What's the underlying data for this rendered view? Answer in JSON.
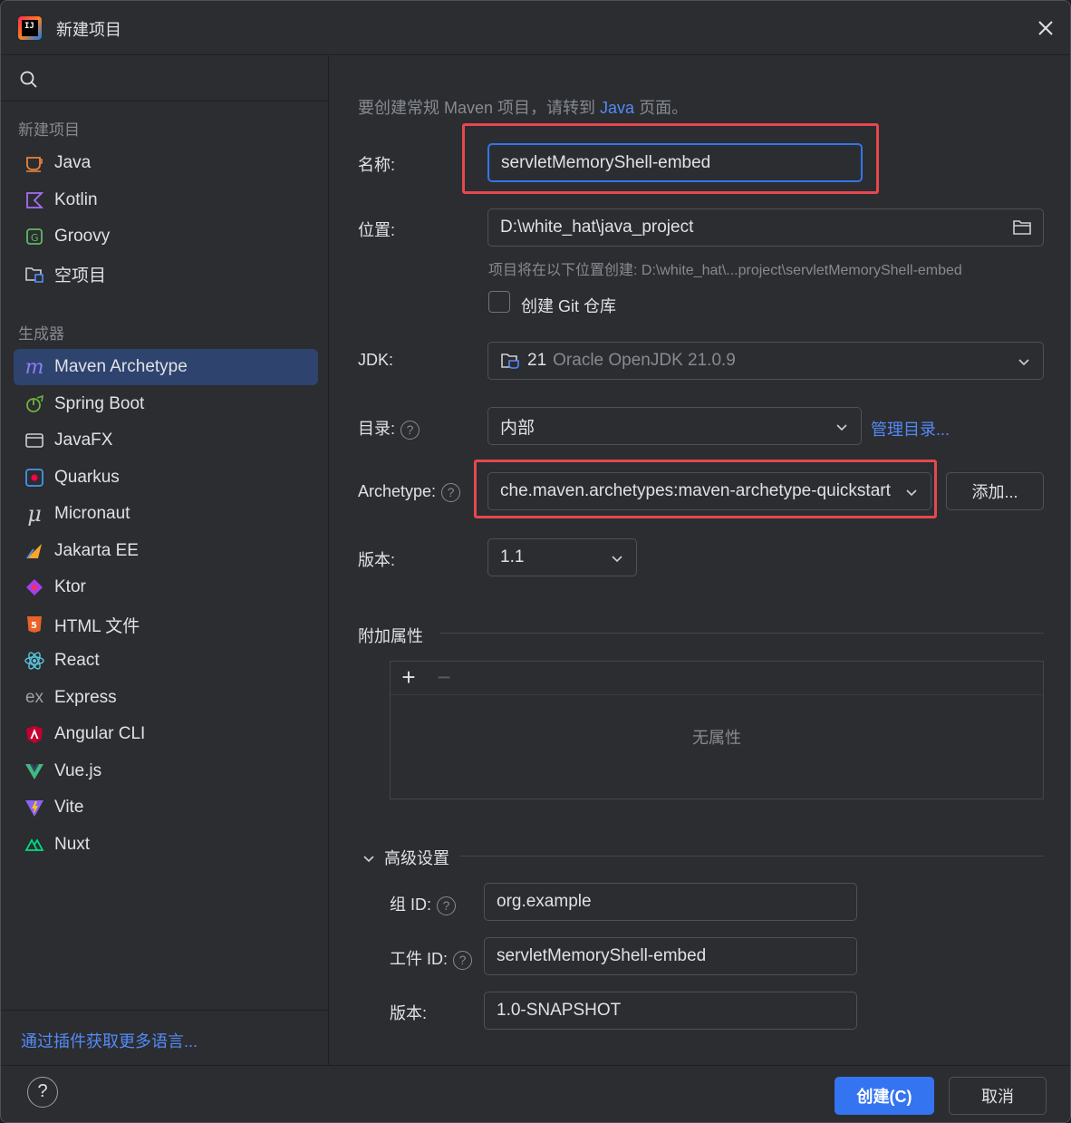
{
  "window": {
    "title": "新建项目",
    "logo_text": "IJ"
  },
  "sidebar": {
    "section_new": "新建项目",
    "new_items": [
      {
        "label": "Java",
        "icon": "java-cup-icon"
      },
      {
        "label": "Kotlin",
        "icon": "kotlin-icon"
      },
      {
        "label": "Groovy",
        "icon": "groovy-icon"
      },
      {
        "label": "空项目",
        "icon": "empty-project-icon"
      }
    ],
    "section_generators": "生成器",
    "generators": [
      {
        "label": "Maven Archetype",
        "icon": "maven-icon",
        "selected": true
      },
      {
        "label": "Spring Boot",
        "icon": "spring-boot-icon"
      },
      {
        "label": "JavaFX",
        "icon": "javafx-icon"
      },
      {
        "label": "Quarkus",
        "icon": "quarkus-icon"
      },
      {
        "label": "Micronaut",
        "icon": "micronaut-icon"
      },
      {
        "label": "Jakarta EE",
        "icon": "jakarta-ee-icon"
      },
      {
        "label": "Ktor",
        "icon": "ktor-icon"
      },
      {
        "label": "HTML 文件",
        "icon": "html5-icon"
      },
      {
        "label": "React",
        "icon": "react-icon"
      },
      {
        "label": "Express",
        "icon": "express-icon"
      },
      {
        "label": "Angular CLI",
        "icon": "angular-icon"
      },
      {
        "label": "Vue.js",
        "icon": "vue-icon"
      },
      {
        "label": "Vite",
        "icon": "vite-icon"
      },
      {
        "label": "Nuxt",
        "icon": "nuxt-icon"
      }
    ],
    "plugins_link": "通过插件获取更多语言..."
  },
  "form": {
    "hint_prefix": "要创建常规 Maven 项目，请转到 ",
    "hint_link": "Java",
    "hint_suffix": " 页面。",
    "name_label": "名称:",
    "name_value": "servletMemoryShell-embed",
    "location_label": "位置:",
    "location_value": "D:\\white_hat\\java_project",
    "location_hint": "项目将在以下位置创建: D:\\white_hat\\...project\\servletMemoryShell-embed",
    "git_label": "创建 Git 仓库",
    "git_checked": false,
    "jdk_label": "JDK:",
    "jdk_version": "21",
    "jdk_name": "Oracle OpenJDK 21.0.9",
    "catalog_label": "目录:",
    "catalog_value": "内部",
    "catalog_manage": "管理目录...",
    "archetype_label": "Archetype:",
    "archetype_value": "che.maven.archetypes:maven-archetype-quickstart",
    "archetype_add": "添加...",
    "version_label": "版本:",
    "version_value": "1.1",
    "props_label": "附加属性",
    "props_empty": "无属性",
    "props_add": "+",
    "props_remove": "−",
    "advanced_label": "高级设置",
    "group_label": "组 ID:",
    "group_value": "org.example",
    "artifact_label": "工件 ID:",
    "artifact_value": "servletMemoryShell-embed",
    "adv_version_label": "版本:",
    "adv_version_value": "1.0-SNAPSHOT"
  },
  "footer": {
    "help": "?",
    "create_label": "创建(C)",
    "cancel_label": "取消"
  },
  "colors": {
    "accent": "#3574f0",
    "link": "#548af7",
    "highlight_box": "#e5484d",
    "selected_bg": "#2e436e"
  }
}
